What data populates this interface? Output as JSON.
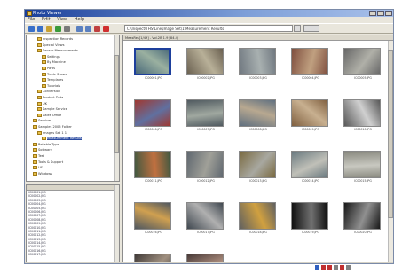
{
  "window": {
    "title": "Photo Viewer"
  },
  "menu": [
    "File",
    "Edit",
    "View",
    "Help"
  ],
  "toolbar_icons": [
    {
      "name": "back-icon",
      "color": "#3a70c8"
    },
    {
      "name": "forward-icon",
      "color": "#3a70c8"
    },
    {
      "name": "up-folder-icon",
      "color": "#c8a030"
    },
    {
      "name": "refresh-icon",
      "color": "#3a9a3a"
    },
    {
      "name": "view-icon",
      "color": "#7a7a7a"
    },
    {
      "name": "copy-icon",
      "color": "#5a80c0"
    },
    {
      "name": "move-icon",
      "color": "#5a80c0"
    },
    {
      "name": "rotate-icon",
      "color": "#c04040"
    },
    {
      "name": "delete-icon",
      "color": "#d03030"
    }
  ],
  "address": {
    "value": "C:\\Inspect\\THS\\Line\\Image Set\\1\\Measurement Results"
  },
  "tree": {
    "items": [
      {
        "label": "Inspection Records",
        "indent": 2
      },
      {
        "label": "Special Views",
        "indent": 2
      },
      {
        "label": "Sensor Measurements",
        "indent": 2
      },
      {
        "label": "Settings",
        "indent": 3
      },
      {
        "label": "By Machine",
        "indent": 3
      },
      {
        "label": "Parts",
        "indent": 3
      },
      {
        "label": "Trade Shows",
        "indent": 3
      },
      {
        "label": "Templates",
        "indent": 3
      },
      {
        "label": "Tutorials",
        "indent": 3
      },
      {
        "label": "Conversion",
        "indent": 2
      },
      {
        "label": "Product Data",
        "indent": 2
      },
      {
        "label": "UK",
        "indent": 2
      },
      {
        "label": "Sample Service",
        "indent": 2
      },
      {
        "label": "Sales Office",
        "indent": 2
      },
      {
        "label": "Services",
        "indent": 1
      },
      {
        "label": "Samples 2005 Folder",
        "indent": 1
      },
      {
        "label": "Images Set 1 1",
        "indent": 2
      },
      {
        "label": "Measurement Results",
        "indent": 3,
        "selected": true
      },
      {
        "label": "Reliable Type",
        "indent": 1
      },
      {
        "label": "Software",
        "indent": 1
      },
      {
        "label": "Test",
        "indent": 1
      },
      {
        "label": "Tools & Support",
        "indent": 1
      },
      {
        "label": "US",
        "indent": 1
      },
      {
        "label": "Windows",
        "indent": 1
      }
    ]
  },
  "files": [
    "IC00001.JPG",
    "IC00002.JPG",
    "IC00003.JPG",
    "IC00004.JPG",
    "IC00005.JPG",
    "IC00006.JPG",
    "IC00007.JPG",
    "IC00008.JPG",
    "IC00009.JPG",
    "IC00010.JPG",
    "IC00011.JPG",
    "IC00012.JPG",
    "IC00013.JPG",
    "IC00014.JPG",
    "IC00015.JPG",
    "IC00016.JPG",
    "IC00017.JPG"
  ],
  "main": {
    "header": "MeasRes[1/49] - Vol.2B 1.9 (84.4)"
  },
  "thumbnails": [
    {
      "caption": "IC00001.JPG",
      "c1": "#4a6a7a",
      "c2": "#9ab0a0",
      "selected": true
    },
    {
      "caption": "IC00002.JPG",
      "c1": "#6a6050",
      "c2": "#b8b098"
    },
    {
      "caption": "IC00003.JPG",
      "c1": "#707880",
      "c2": "#a8b0b0"
    },
    {
      "caption": "IC00004.JPG",
      "c1": "#805040",
      "c2": "#c0a080"
    },
    {
      "caption": "IC00005.JPG",
      "c1": "#686868",
      "c2": "#b0b0a8"
    },
    {
      "caption": "IC00006.JPG",
      "c1": "#a03830",
      "c2": "#6070a0"
    },
    {
      "caption": "IC00007.JPG",
      "c1": "#505a60",
      "c2": "#a0a8a0"
    },
    {
      "caption": "IC00008.JPG",
      "c1": "#607080",
      "c2": "#b8a890"
    },
    {
      "caption": "IC00009.JPG",
      "c1": "#806040",
      "c2": "#c8b090"
    },
    {
      "caption": "IC00010.JPG",
      "c1": "#585858",
      "c2": "#d0d0d0"
    },
    {
      "caption": "IC00011.JPG",
      "c1": "#405840",
      "c2": "#c07040"
    },
    {
      "caption": "IC00012.JPG",
      "c1": "#606870",
      "c2": "#a0a098"
    },
    {
      "caption": "IC00013.JPG",
      "c1": "#7a6a40",
      "c2": "#a8a8a0"
    },
    {
      "caption": "IC00014.JPG",
      "c1": "#6a7a80",
      "c2": "#c0c0b8"
    },
    {
      "caption": "IC00015.JPG",
      "c1": "#8a8a80",
      "c2": "#c8c8c0"
    },
    {
      "caption": "IC00016.JPG",
      "c1": "#505860",
      "c2": "#d0a050"
    },
    {
      "caption": "IC00017.JPG",
      "c1": "#404850",
      "c2": "#b0b0b0"
    },
    {
      "caption": "IC00018.JPG",
      "c1": "#606060",
      "c2": "#d0a040"
    },
    {
      "caption": "IC00019.JPG",
      "c1": "#101010",
      "c2": "#707070"
    },
    {
      "caption": "IC00020.JPG",
      "c1": "#181818",
      "c2": "#909090"
    },
    {
      "caption": "",
      "c1": "#403a38",
      "c2": "#a09080"
    },
    {
      "caption": "",
      "c1": "#483a38",
      "c2": "#b09080"
    }
  ],
  "tray_icons": [
    {
      "name": "network-icon",
      "color": "#3060c0"
    },
    {
      "name": "volume-icon",
      "color": "#c03030"
    },
    {
      "name": "security-icon",
      "color": "#c03030"
    },
    {
      "name": "clock-icon",
      "color": "#808080"
    },
    {
      "name": "display-icon",
      "color": "#c03030"
    },
    {
      "name": "battery-icon",
      "color": "#808080"
    }
  ]
}
